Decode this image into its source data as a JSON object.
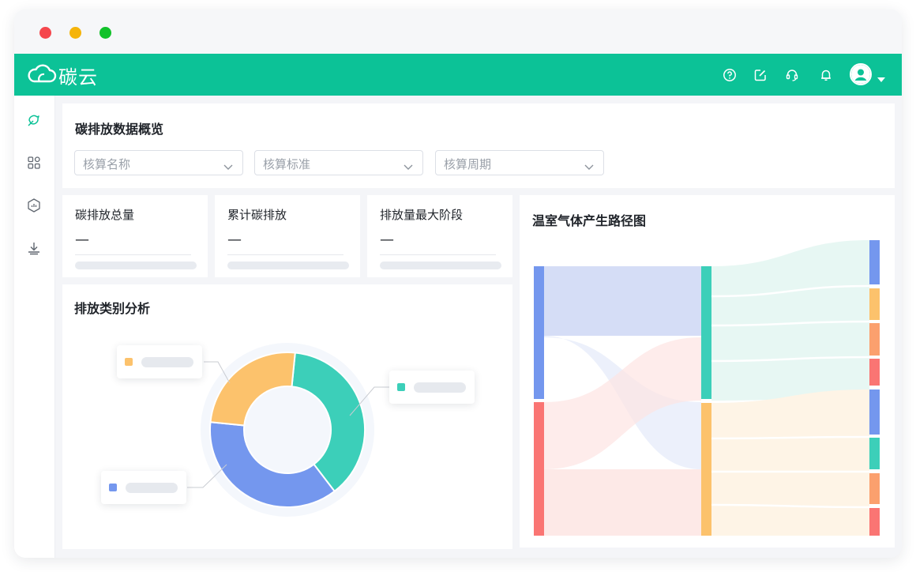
{
  "window": {
    "controls": [
      "close",
      "minimize",
      "maximize"
    ]
  },
  "brand": {
    "name": "碳云",
    "icon": "cloud-icon",
    "color": "#0cc297"
  },
  "topbar": {
    "icons": [
      "help-circle-icon",
      "edit-icon",
      "headset-icon",
      "bell-icon"
    ],
    "avatar_icon": "user-avatar-icon",
    "menu_icon": "caret-down-icon"
  },
  "sidebar": {
    "items": [
      "leaf-icon",
      "apps-grid-icon",
      "hexagon-chart-icon",
      "download-icon"
    ]
  },
  "overview": {
    "title": "碳排放数据概览",
    "filters": [
      {
        "placeholder": "核算名称"
      },
      {
        "placeholder": "核算标准"
      },
      {
        "placeholder": "核算周期"
      }
    ]
  },
  "stats": [
    {
      "label": "碳排放总量",
      "value": "—"
    },
    {
      "label": "累计碳排放",
      "value": "—"
    },
    {
      "label": "排放量最大阶段",
      "value": "—"
    }
  ],
  "category": {
    "title": "排放类别分析",
    "chart_data": {
      "type": "pie",
      "slices": [
        {
          "color": "#3ccfb9",
          "fraction": 0.38
        },
        {
          "color": "#7497ee",
          "fraction": 0.37
        },
        {
          "color": "#fcc26c",
          "fraction": 0.25
        }
      ]
    }
  },
  "sankey": {
    "title": "温室气体产生路径图",
    "colors": {
      "blue": "#7497ee",
      "red": "#fa7573",
      "teal": "#3ccfb9",
      "yellow": "#fcc26c",
      "orange": "#fba06e"
    }
  }
}
